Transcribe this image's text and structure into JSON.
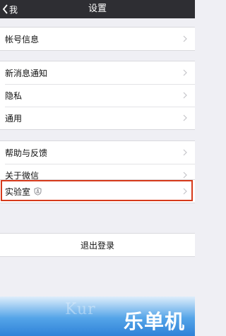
{
  "nav": {
    "back_label": "我",
    "title": "设置"
  },
  "groups": [
    {
      "items": [
        {
          "label": "帐号信息"
        }
      ]
    },
    {
      "items": [
        {
          "label": "新消息通知"
        },
        {
          "label": "隐私"
        },
        {
          "label": "通用"
        }
      ]
    },
    {
      "items": [
        {
          "label": "帮助与反馈"
        },
        {
          "label": "关于微信"
        }
      ]
    },
    {
      "items": [
        {
          "label": "实验室",
          "icon": "flask-shield-icon"
        }
      ]
    }
  ],
  "logout": {
    "label": "退出登录"
  },
  "watermark": {
    "brand": "Kur",
    "site": "乐单机"
  },
  "colors": {
    "nav_bg": "#2e2e33",
    "page_bg": "#efeff4",
    "highlight": "#d63a1b"
  }
}
